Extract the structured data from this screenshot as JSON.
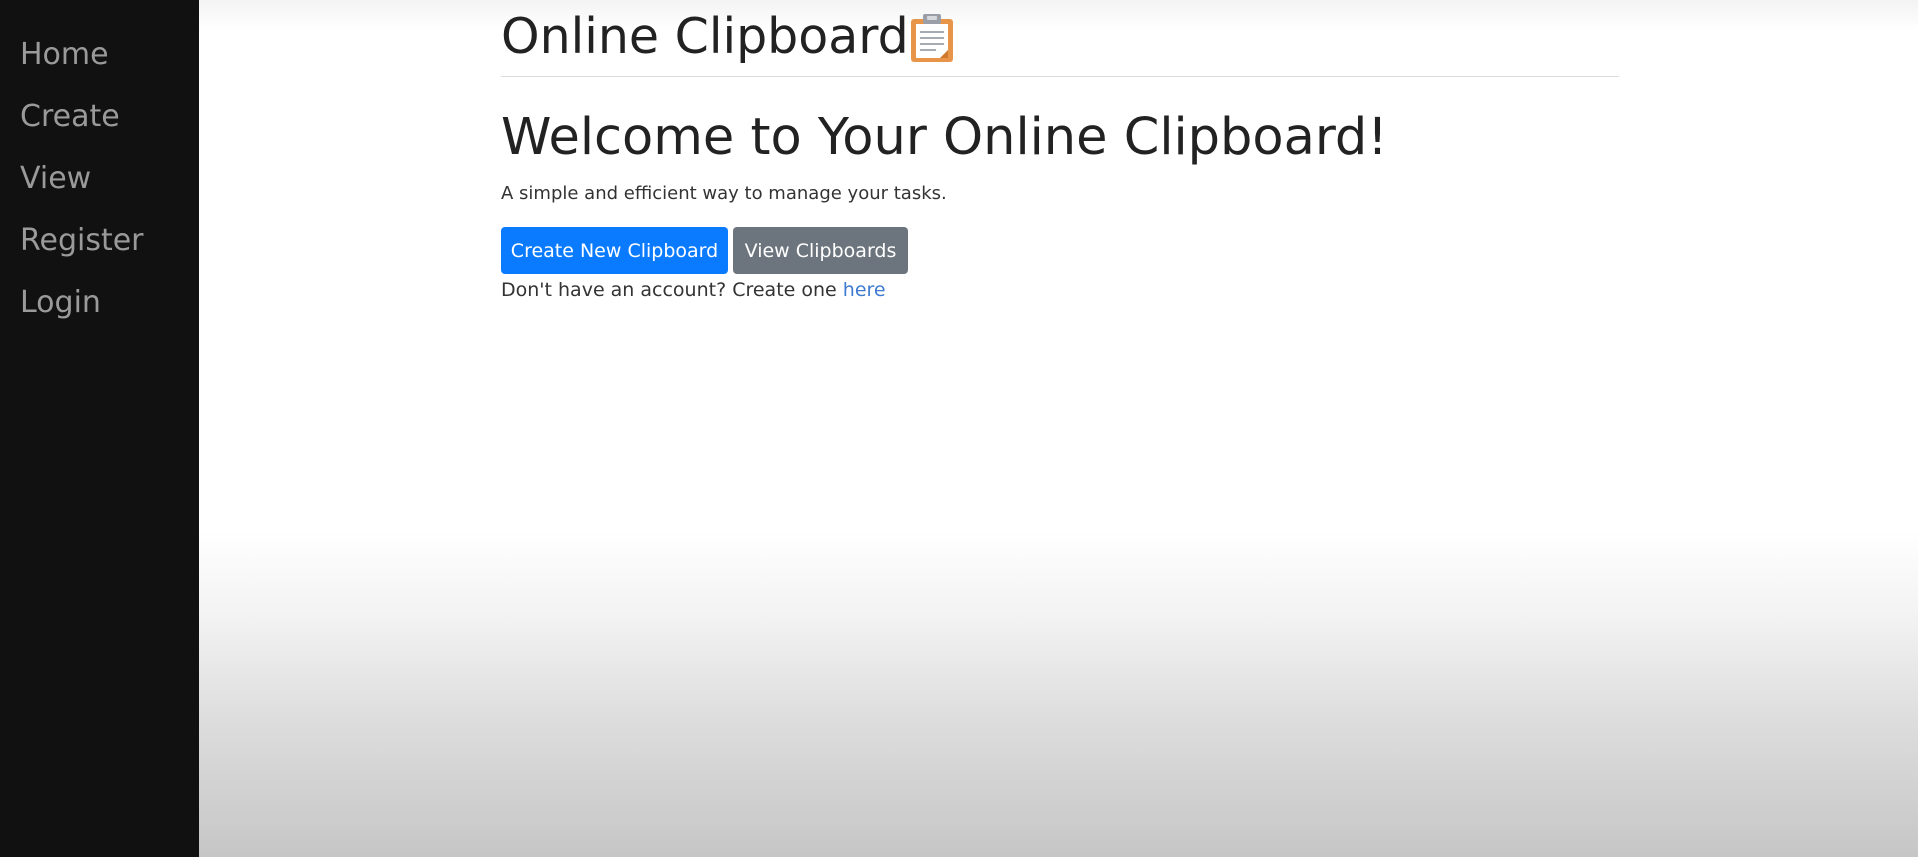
{
  "sidebar": {
    "items": [
      {
        "label": "Home"
      },
      {
        "label": "Create"
      },
      {
        "label": "View"
      },
      {
        "label": "Register"
      },
      {
        "label": "Login"
      }
    ]
  },
  "header": {
    "title": "Online Clipboard",
    "icon": "clipboard-icon"
  },
  "main": {
    "heading": "Welcome to Your Online Clipboard!",
    "lead": "A simple and efficient way to manage your tasks.",
    "buttons": {
      "create": "Create New Clipboard",
      "view": "View Clipboards"
    },
    "account_note": {
      "text": "Don't have an account? Create one ",
      "link": "here"
    }
  },
  "colors": {
    "sidebar_bg": "#111111",
    "sidebar_text": "#9a9a9a",
    "primary": "#0a7bff",
    "secondary": "#6c757d",
    "link": "#3e7bd1"
  }
}
